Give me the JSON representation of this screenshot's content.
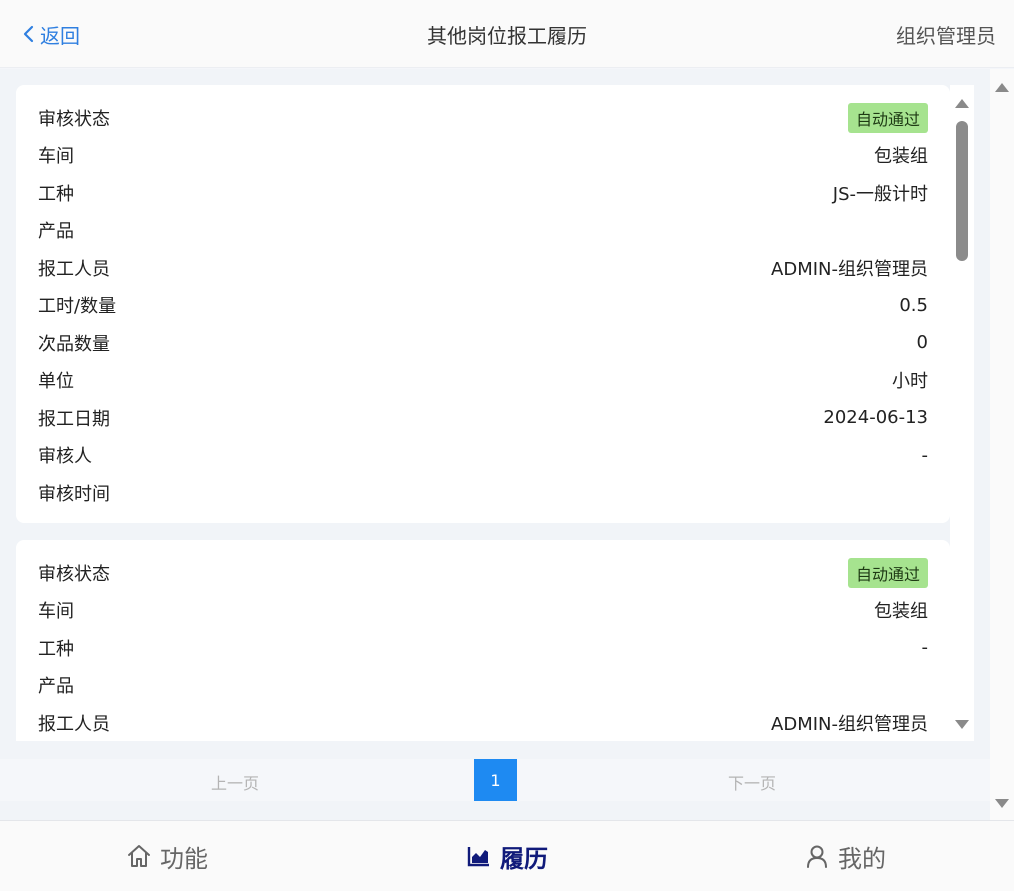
{
  "header": {
    "back_label": "返回",
    "title": "其他岗位报工履历",
    "org_label": "组织管理员"
  },
  "records": [
    {
      "status": "自动通过",
      "labels": {
        "status": "审核状态",
        "workshop": "车间",
        "work_type": "工种",
        "product": "产品",
        "reporter": "报工人员",
        "hours_qty": "工时/数量",
        "defect_qty": "次品数量",
        "unit": "单位",
        "report_date": "报工日期",
        "reviewer": "审核人",
        "review_time": "审核时间"
      },
      "values": {
        "workshop": "包装组",
        "work_type": "JS-一般计时",
        "product": "",
        "reporter": "ADMIN-组织管理员",
        "hours_qty": "0.5",
        "defect_qty": "0",
        "unit": "小时",
        "report_date": "2024-06-13",
        "reviewer": "-",
        "review_time": ""
      }
    },
    {
      "status": "自动通过",
      "labels": {
        "status": "审核状态",
        "workshop": "车间",
        "work_type": "工种",
        "product": "产品",
        "reporter": "报工人员"
      },
      "values": {
        "workshop": "包装组",
        "work_type": "-",
        "product": "",
        "reporter": "ADMIN-组织管理员"
      }
    }
  ],
  "pagination": {
    "prev_label": "上一页",
    "current_page": "1",
    "next_label": "下一页"
  },
  "tabbar": {
    "function_label": "功能",
    "history_label": "履历",
    "mine_label": "我的"
  },
  "colors": {
    "accent": "#1e8af2",
    "link": "#2f7fe0",
    "badge_bg": "#a6e38f",
    "active_tab": "#101a7a"
  },
  "icons": {
    "back": "chevron-left-icon",
    "function": "home-icon",
    "history": "bar-chart-icon",
    "mine": "user-icon"
  }
}
